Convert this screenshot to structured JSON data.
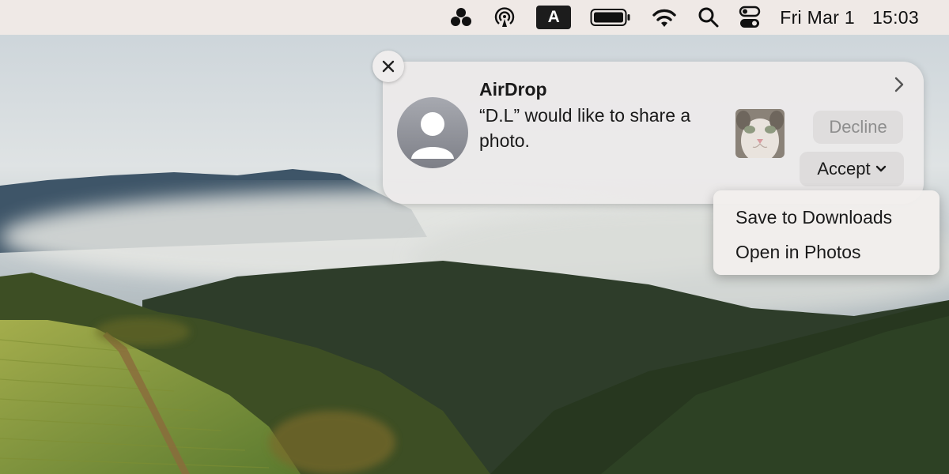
{
  "menubar": {
    "icons": [
      "control-strip-icon",
      "airdrop-icon",
      "input-source-icon",
      "battery-icon",
      "wifi-icon",
      "search-icon",
      "control-center-icon"
    ],
    "input_source_letter": "A",
    "date": "Fri Mar 1",
    "time": "15:03"
  },
  "notification": {
    "app": "AirDrop",
    "message": "“D.L” would like to share a photo.",
    "decline_label": "Decline",
    "accept_label": "Accept",
    "icons": [
      "close-icon",
      "person-avatar-icon",
      "chevron-right-icon",
      "cat-photo-thumbnail",
      "chevron-down-icon"
    ]
  },
  "accept_menu": {
    "items": [
      "Save to Downloads",
      "Open in Photos"
    ]
  },
  "colors": {
    "menubar_bg": "#efe9e6",
    "notification_bg": "#eceaea",
    "button_bg": "#dedcdc",
    "decline_text": "#8e8e8e"
  }
}
